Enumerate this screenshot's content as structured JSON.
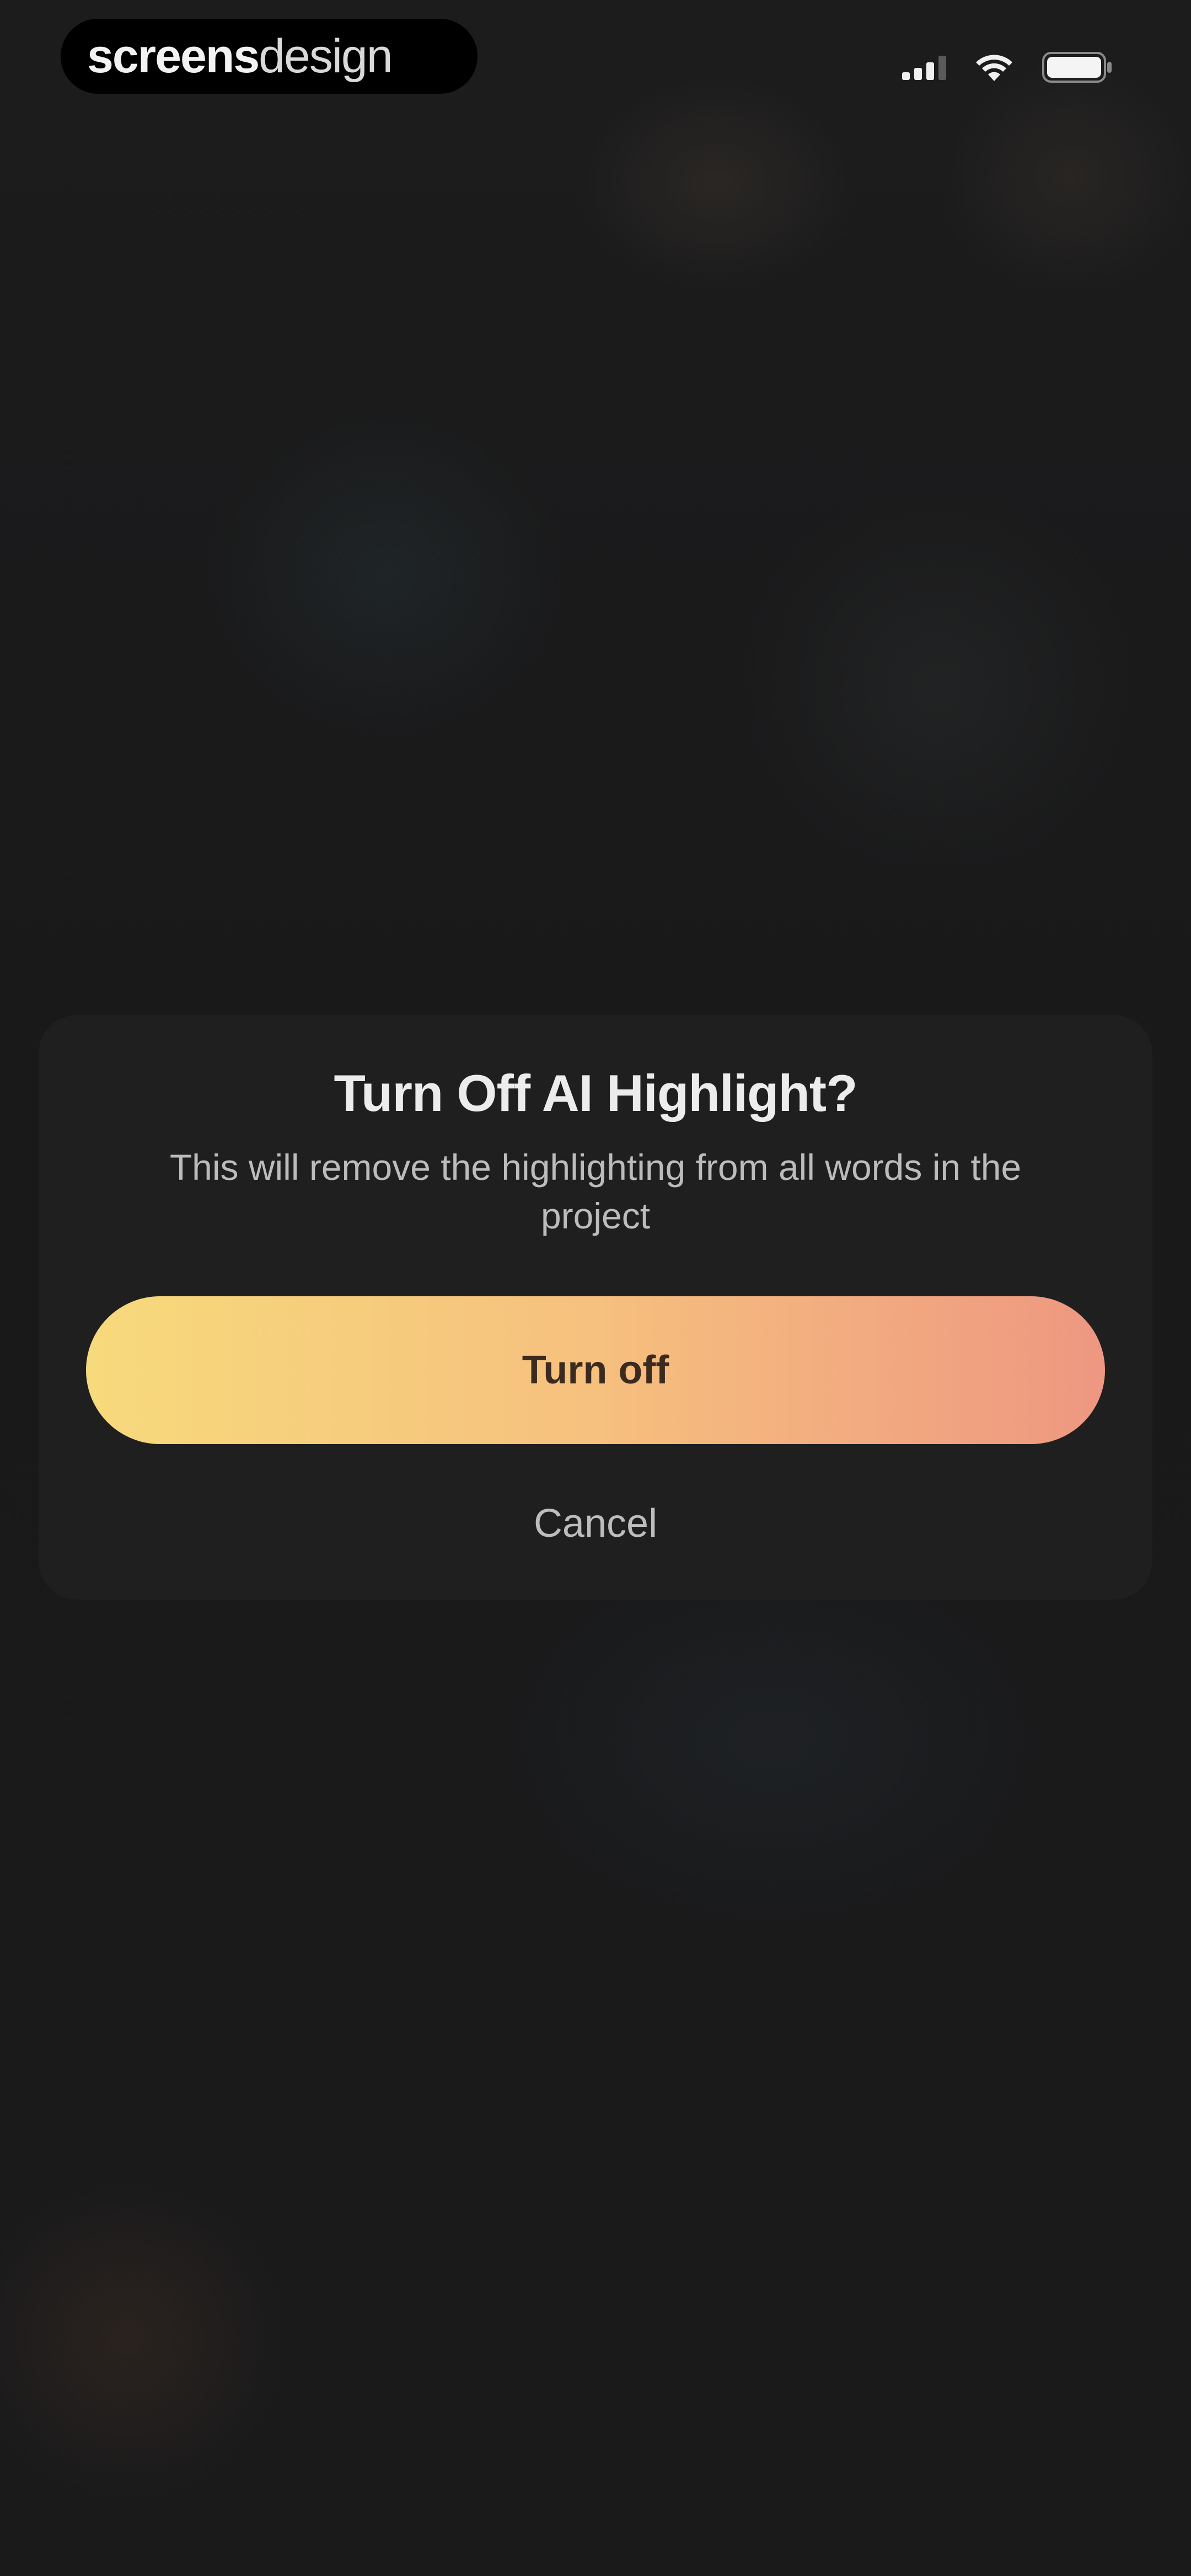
{
  "status_bar": {
    "brand_bold": "screens",
    "brand_light": "design",
    "icons": [
      "signal-icon",
      "wifi-icon",
      "battery-icon"
    ]
  },
  "dialog": {
    "title": "Turn Off AI Highlight?",
    "message": "This will remove the highlighting from all words in the project",
    "primary_button_label": "Turn off",
    "secondary_button_label": "Cancel"
  },
  "colors": {
    "background": "#1b1b1c",
    "dialog_background": "#1f1f20",
    "button_gradient_start": "#f7da7c",
    "button_gradient_end": "#ee9781",
    "button_text": "#3b2a1f"
  }
}
